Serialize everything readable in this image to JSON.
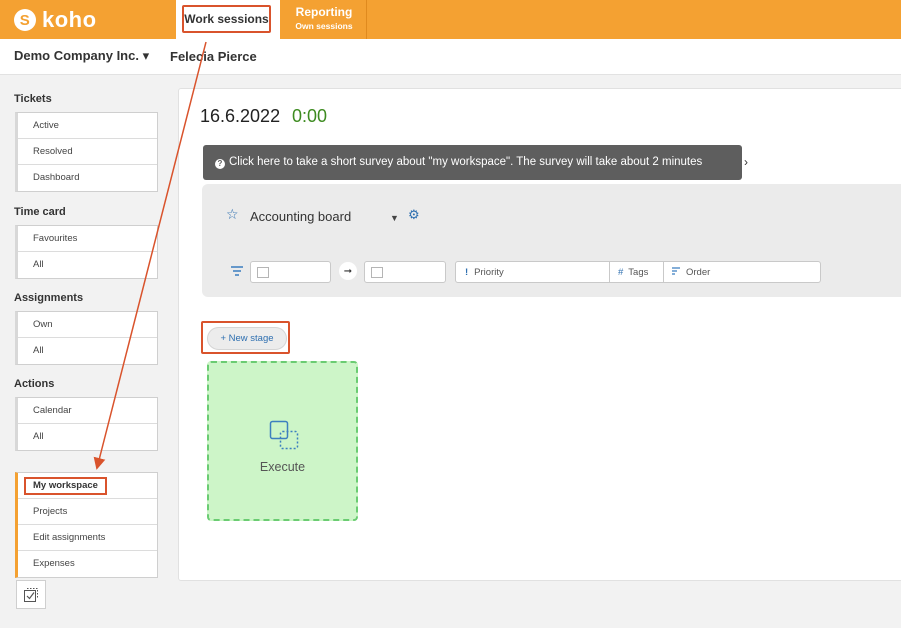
{
  "app": {
    "logo_text": "koho",
    "logo_mark": "S"
  },
  "tabs": [
    {
      "label": "Work sessions"
    },
    {
      "label": "Reporting",
      "sublabel": "Own sessions"
    }
  ],
  "subheader": {
    "company": "Demo Company Inc. ▾",
    "user": "Felecia Pierce"
  },
  "sidebar": {
    "tickets": {
      "title": "Tickets",
      "items": [
        "Active",
        "Resolved",
        "Dashboard"
      ]
    },
    "timecard": {
      "title": "Time card",
      "items": [
        "Favourites",
        "All"
      ]
    },
    "assignments": {
      "title": "Assignments",
      "items": [
        "Own",
        "All"
      ]
    },
    "actions": {
      "title": "Actions",
      "items": [
        "Calendar",
        "All"
      ]
    },
    "workspace": {
      "items": [
        "My workspace",
        "Projects",
        "Edit assignments",
        "Expenses"
      ]
    }
  },
  "main": {
    "date": "16.6.2022",
    "time": "0:00",
    "survey": "Click here to take a short survey about \"my workspace\". The survey will take about 2 minutes",
    "board_name": "Accounting board",
    "filters": {
      "priority": "Priority",
      "tags": "Tags",
      "order": "Order"
    },
    "new_stage": "+ New stage",
    "stage_label": "Execute"
  },
  "colors": {
    "brand": "#f4a132",
    "annotation": "#d9532c",
    "link": "#2e6fb0",
    "time": "#3d8b20",
    "stage_bg": "#cdf5c8"
  }
}
